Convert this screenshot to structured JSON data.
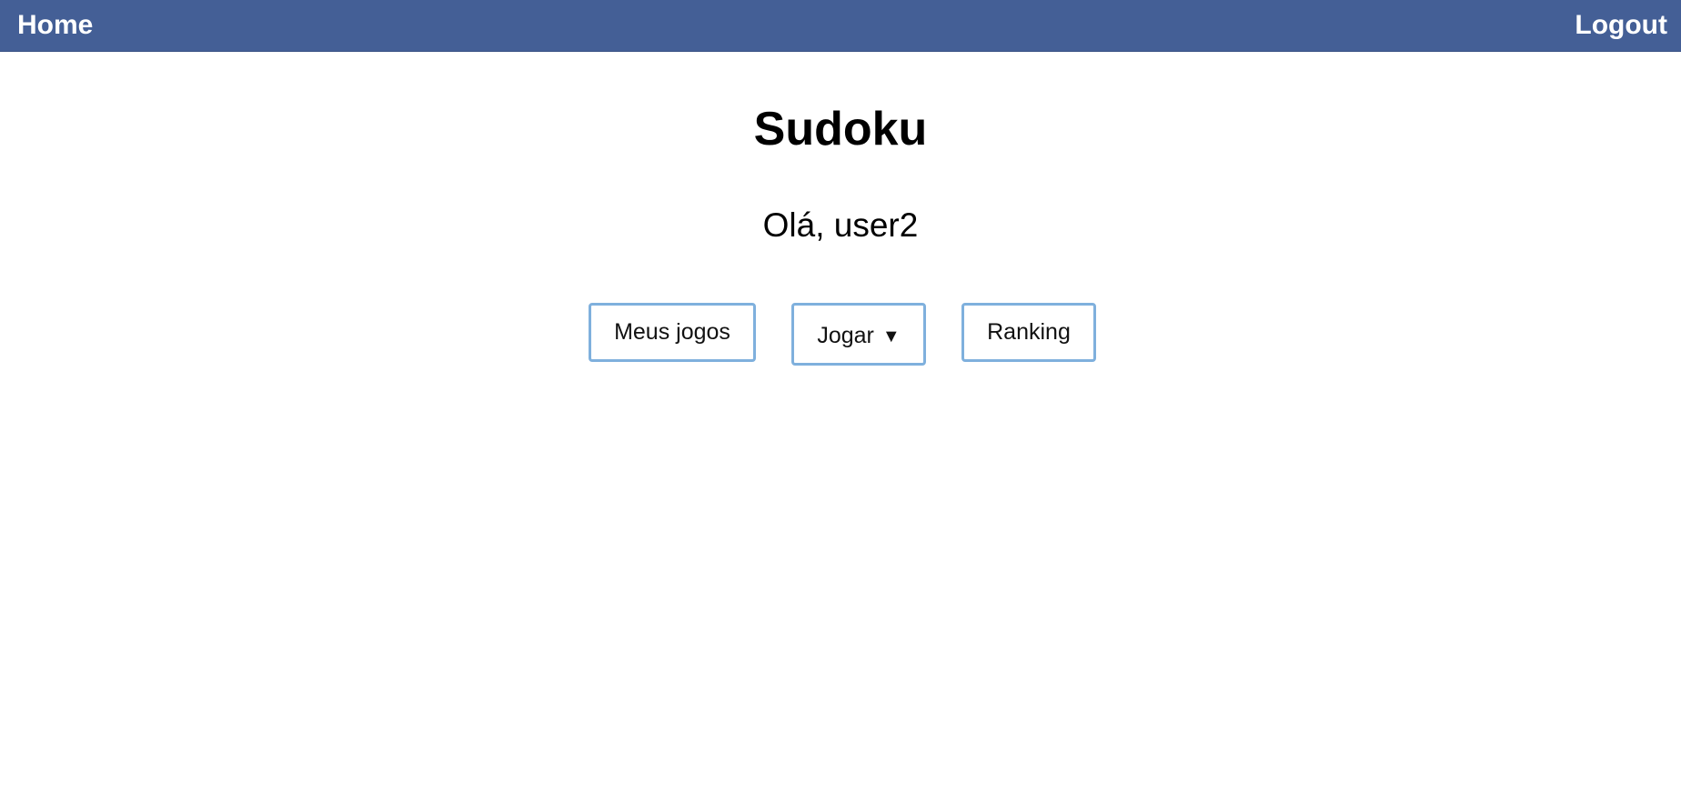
{
  "navbar": {
    "home_label": "Home",
    "logout_label": "Logout",
    "background_color": "#445f96"
  },
  "main": {
    "title": "Sudoku",
    "greeting": "Olá, user2",
    "buttons": {
      "meus_jogos": "Meus jogos",
      "jogar": "Jogar",
      "jogar_caret": "▼",
      "ranking": "Ranking"
    },
    "button_border_color": "#7fb0dd"
  }
}
